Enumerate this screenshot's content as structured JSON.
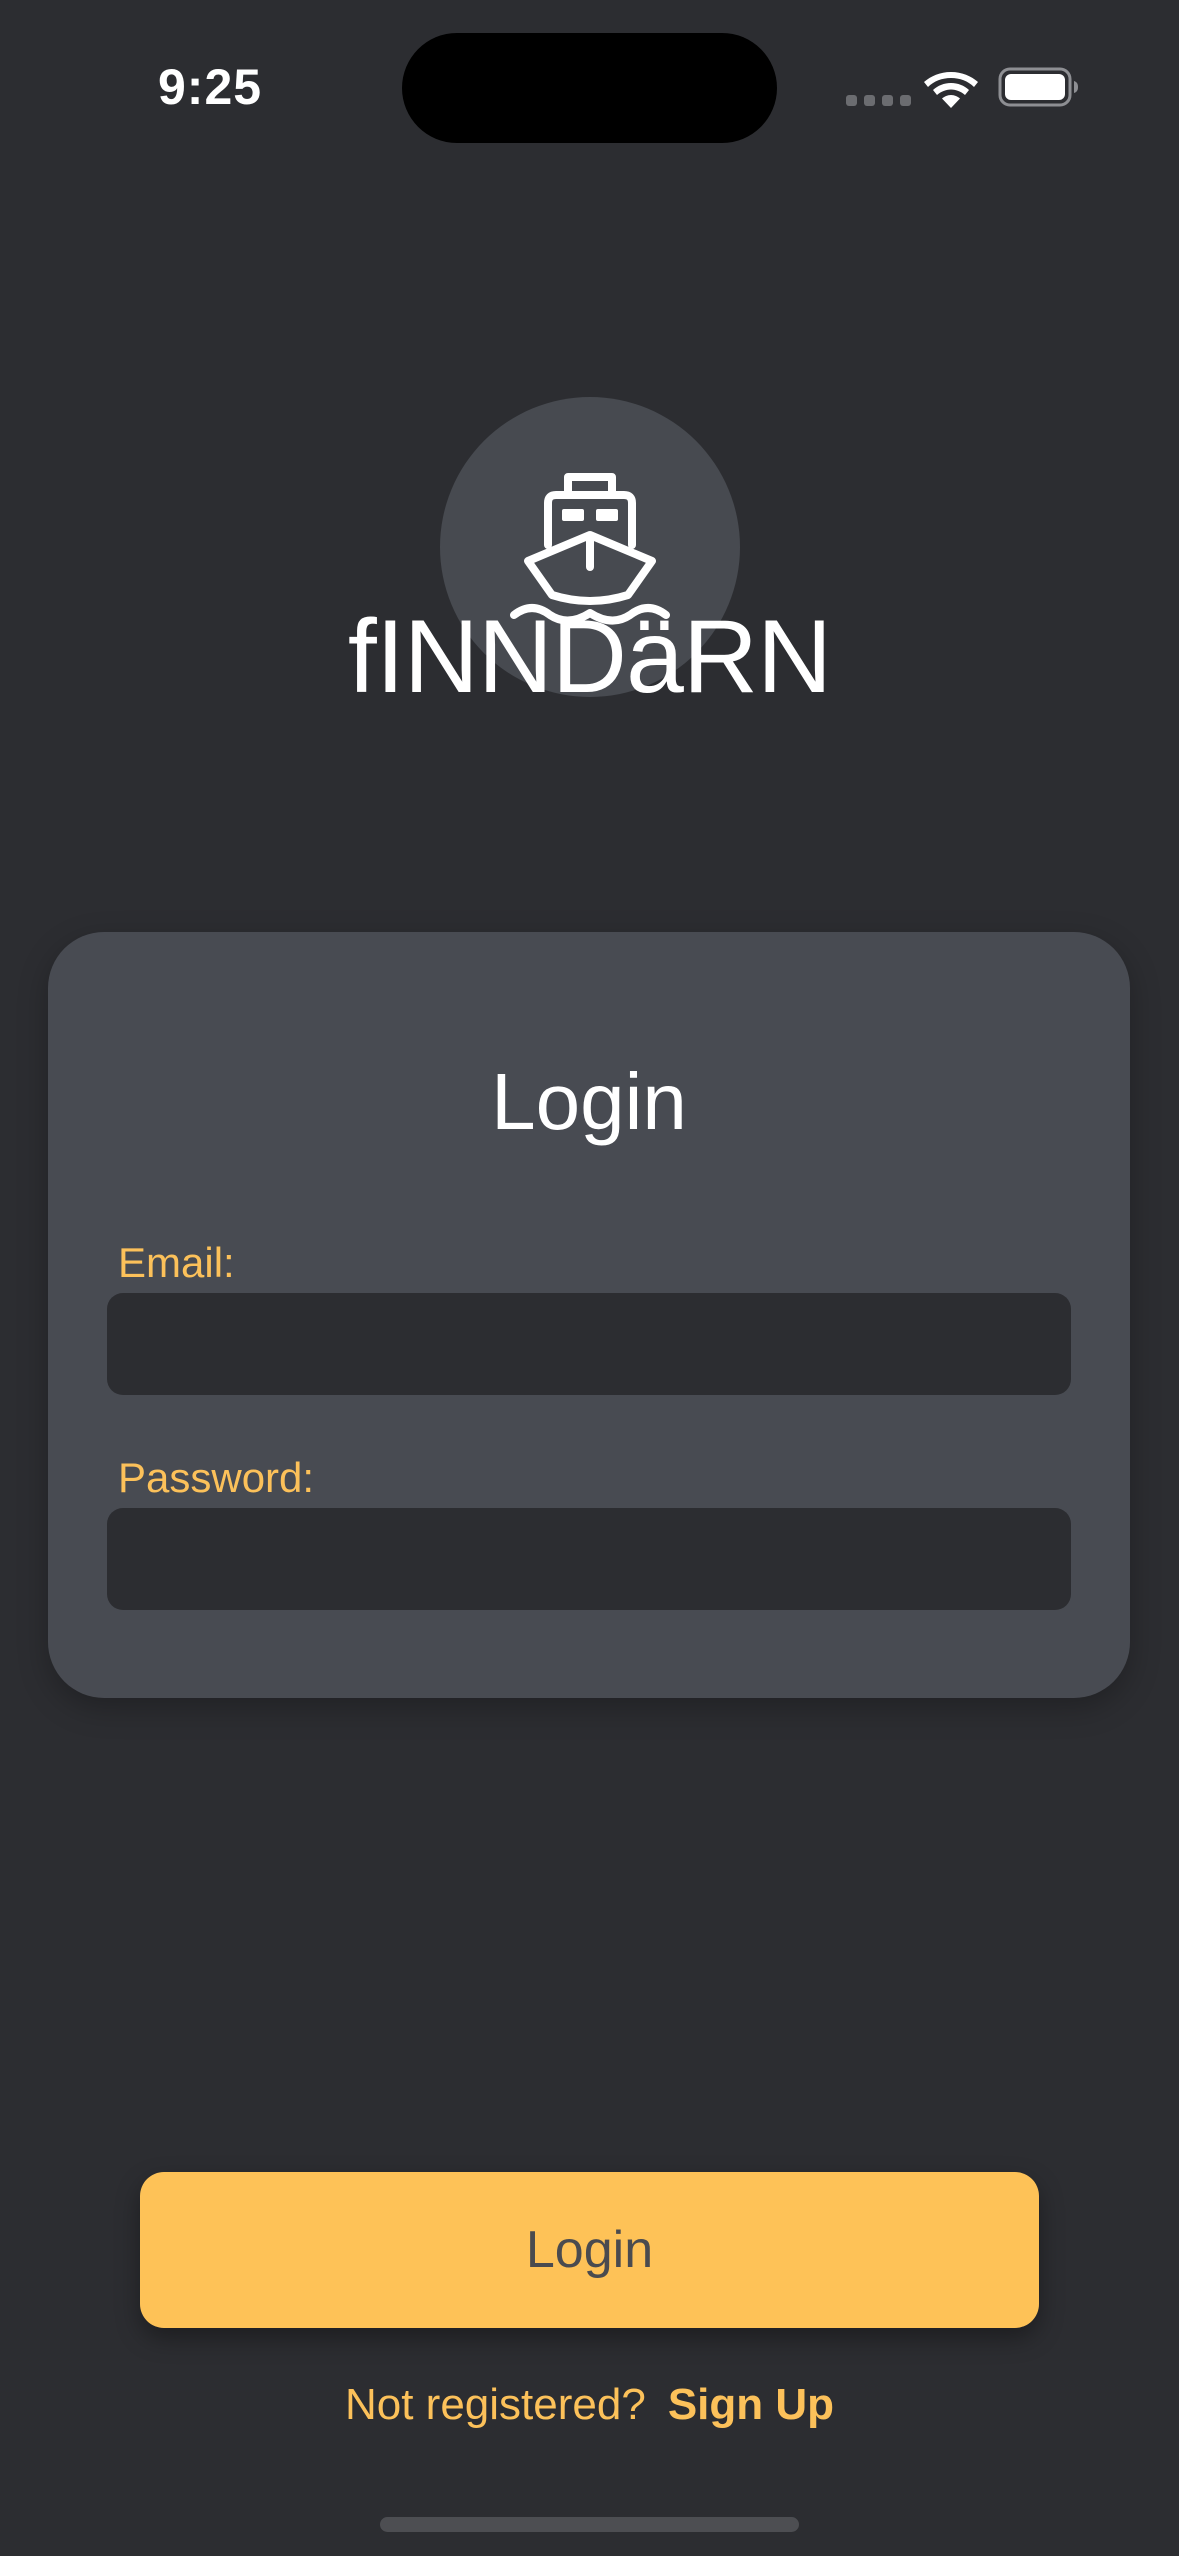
{
  "status_bar": {
    "time": "9:25",
    "wifi_icon": "wifi-icon",
    "battery_icon": "battery-icon"
  },
  "logo": {
    "icon": "ship-icon",
    "app_name": "fINNDäRN"
  },
  "login_card": {
    "title": "Login",
    "email_label": "Email:",
    "email_value": "",
    "password_label": "Password:",
    "password_value": ""
  },
  "login_button": {
    "label": "Login"
  },
  "footer": {
    "prompt": "Not registered?",
    "signup_label": "Sign Up"
  },
  "colors": {
    "background": "#2c2d31",
    "card": "#484b52",
    "accent": "#fec257",
    "label": "#fcc15a"
  }
}
